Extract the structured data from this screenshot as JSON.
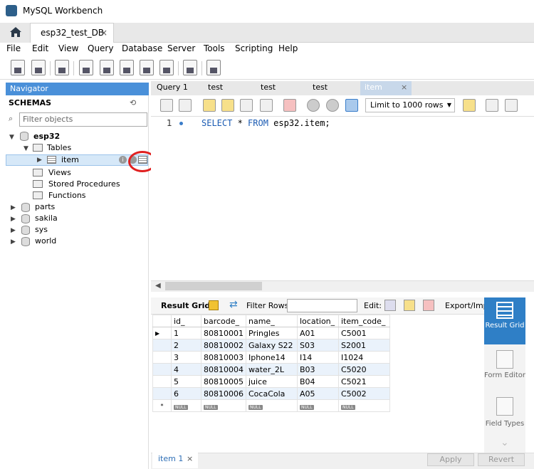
{
  "window": {
    "title": "MySQL Workbench"
  },
  "tabs": {
    "connection_tab": "esp32_test_DB",
    "close": "×"
  },
  "menu": [
    "File",
    "Edit",
    "View",
    "Query",
    "Database",
    "Server",
    "Tools",
    "Scripting",
    "Help"
  ],
  "navigator": {
    "title": "Navigator",
    "schemas_label": "SCHEMAS",
    "filter_placeholder": "Filter objects",
    "tree": {
      "schema": "esp32",
      "tables_folder": "Tables",
      "table_item": "item",
      "views": "Views",
      "stored_procedures": "Stored Procedures",
      "functions": "Functions",
      "other_schemas": [
        "parts",
        "sakila",
        "sys",
        "world"
      ]
    }
  },
  "query_tabs": [
    "Query 1",
    "test",
    "test",
    "test",
    "item"
  ],
  "query_toolbar": {
    "limit_label": "Limit to 1000 rows"
  },
  "editor": {
    "line_number": "1",
    "sql_keyword1": "SELECT",
    "sql_star": " * ",
    "sql_keyword2": "FROM",
    "sql_rest": " esp32.item;"
  },
  "result": {
    "grid_label": "Result Grid",
    "filter_label": "Filter Rows:",
    "edit_label": "Edit:",
    "export_label": "Export/Impo",
    "columns": [
      "id_",
      "barcode_",
      "name_",
      "location_",
      "item_code_"
    ],
    "rows": [
      [
        "1",
        "80810001",
        "Pringles",
        "A01",
        "C5001"
      ],
      [
        "2",
        "80810002",
        "Galaxy S22",
        "S03",
        "S2001"
      ],
      [
        "3",
        "80810003",
        "Iphone14",
        "I14",
        "I1024"
      ],
      [
        "4",
        "80810004",
        "water_2L",
        "B03",
        "C5020"
      ],
      [
        "5",
        "80810005",
        "juice",
        "B04",
        "C5021"
      ],
      [
        "6",
        "80810006",
        "CocaCola",
        "A05",
        "C5002"
      ]
    ],
    "null_label": "NULL",
    "new_row_marker": "*"
  },
  "result_side": {
    "result_grid": "Result Grid",
    "form_editor": "Form Editor",
    "field_types": "Field Types"
  },
  "bottom": {
    "result_tab": "item 1",
    "close": "×",
    "apply": "Apply",
    "revert": "Revert"
  }
}
